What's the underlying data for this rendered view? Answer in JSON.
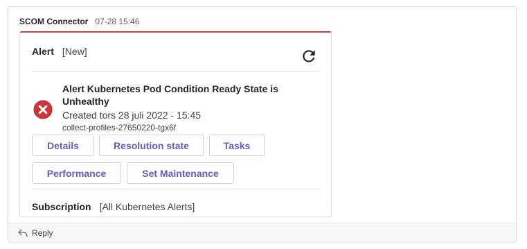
{
  "message": {
    "sender": "SCOM Connector",
    "timestamp": "07-28 15:46"
  },
  "card": {
    "accent_color": "#e53935",
    "alert_label": "Alert",
    "alert_state": "[New]",
    "refresh_icon": "refresh-icon",
    "alert": {
      "icon": "error-icon",
      "title": "Alert Kubernetes Pod Condition Ready State is Unhealthy",
      "created": "Created tors 28 juli 2022 - 15:45",
      "source": "collect-profiles-27650220-tgx6f"
    },
    "actions": [
      {
        "label": "Details"
      },
      {
        "label": "Resolution state"
      },
      {
        "label": "Tasks"
      },
      {
        "label": "Performance"
      },
      {
        "label": "Set Maintenance"
      }
    ],
    "subscription_label": "Subscription",
    "subscription_value": "[All Kubernetes Alerts]"
  },
  "reply": {
    "label": "Reply",
    "icon": "reply-icon"
  }
}
